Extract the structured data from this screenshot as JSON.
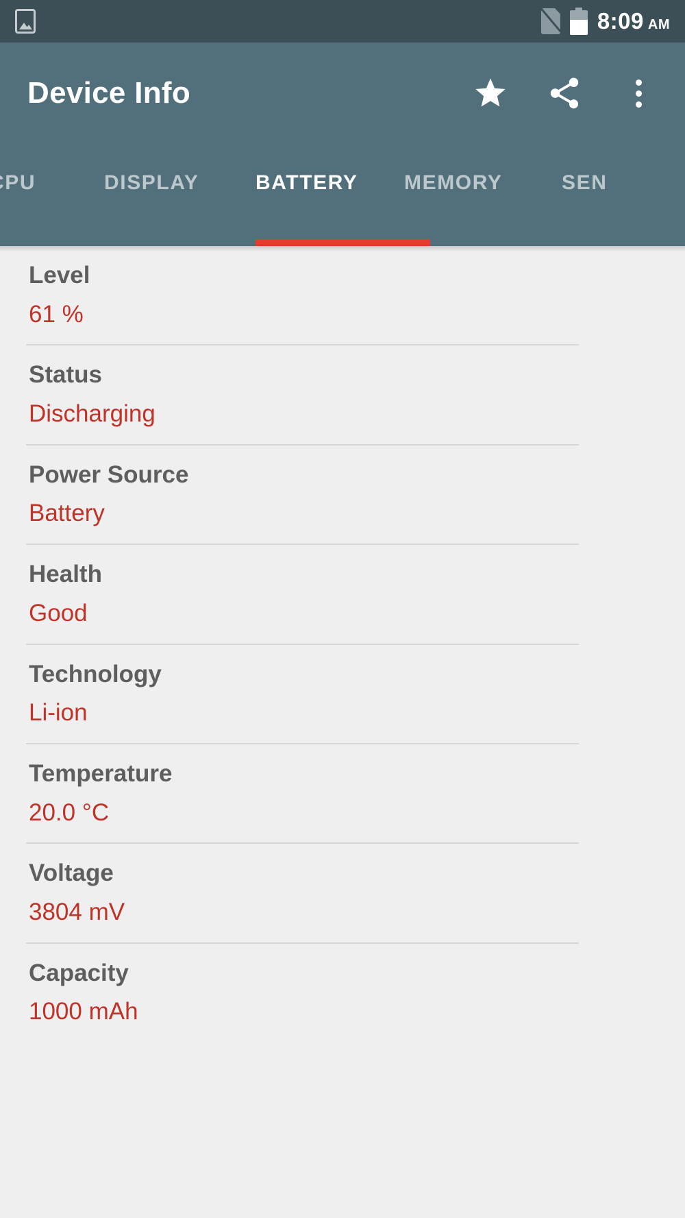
{
  "status_bar": {
    "icons": [
      "screenshot-icon",
      "no-sim-icon",
      "battery-icon"
    ],
    "battery_fill_percent": 62,
    "time": "8:09",
    "meridiem": "AM"
  },
  "app_bar": {
    "title": "Device Info",
    "actions": [
      {
        "name": "favorite-button",
        "icon": "star-icon",
        "label": "Favorite"
      },
      {
        "name": "share-button",
        "icon": "share-icon",
        "label": "Share"
      },
      {
        "name": "overflow-menu-button",
        "icon": "more-vert-icon",
        "label": "More options"
      }
    ]
  },
  "tabs": {
    "items": [
      {
        "label": "CPU",
        "active": false
      },
      {
        "label": "DISPLAY",
        "active": false
      },
      {
        "label": "BATTERY",
        "active": true
      },
      {
        "label": "MEMORY",
        "active": false
      },
      {
        "label": "SEN",
        "active": false
      }
    ],
    "active_index": 2,
    "indicator_color": "#E8392C"
  },
  "battery": {
    "rows": [
      {
        "label": "Level",
        "value": "61 %"
      },
      {
        "label": "Status",
        "value": "Discharging"
      },
      {
        "label": "Power Source",
        "value": "Battery"
      },
      {
        "label": "Health",
        "value": "Good"
      },
      {
        "label": "Technology",
        "value": "Li-ion"
      },
      {
        "label": "Temperature",
        "value": "20.0 °C"
      },
      {
        "label": "Voltage",
        "value": "3804 mV"
      },
      {
        "label": "Capacity",
        "value": "1000 mAh"
      }
    ]
  },
  "colors": {
    "status_bar_bg": "#3C4F57",
    "app_bar_bg": "#52707C",
    "content_bg": "#EFEFEF",
    "label_text": "#5E5E5E",
    "value_text": "#BF3328",
    "accent": "#E8392C",
    "divider": "#D6D6D6"
  }
}
